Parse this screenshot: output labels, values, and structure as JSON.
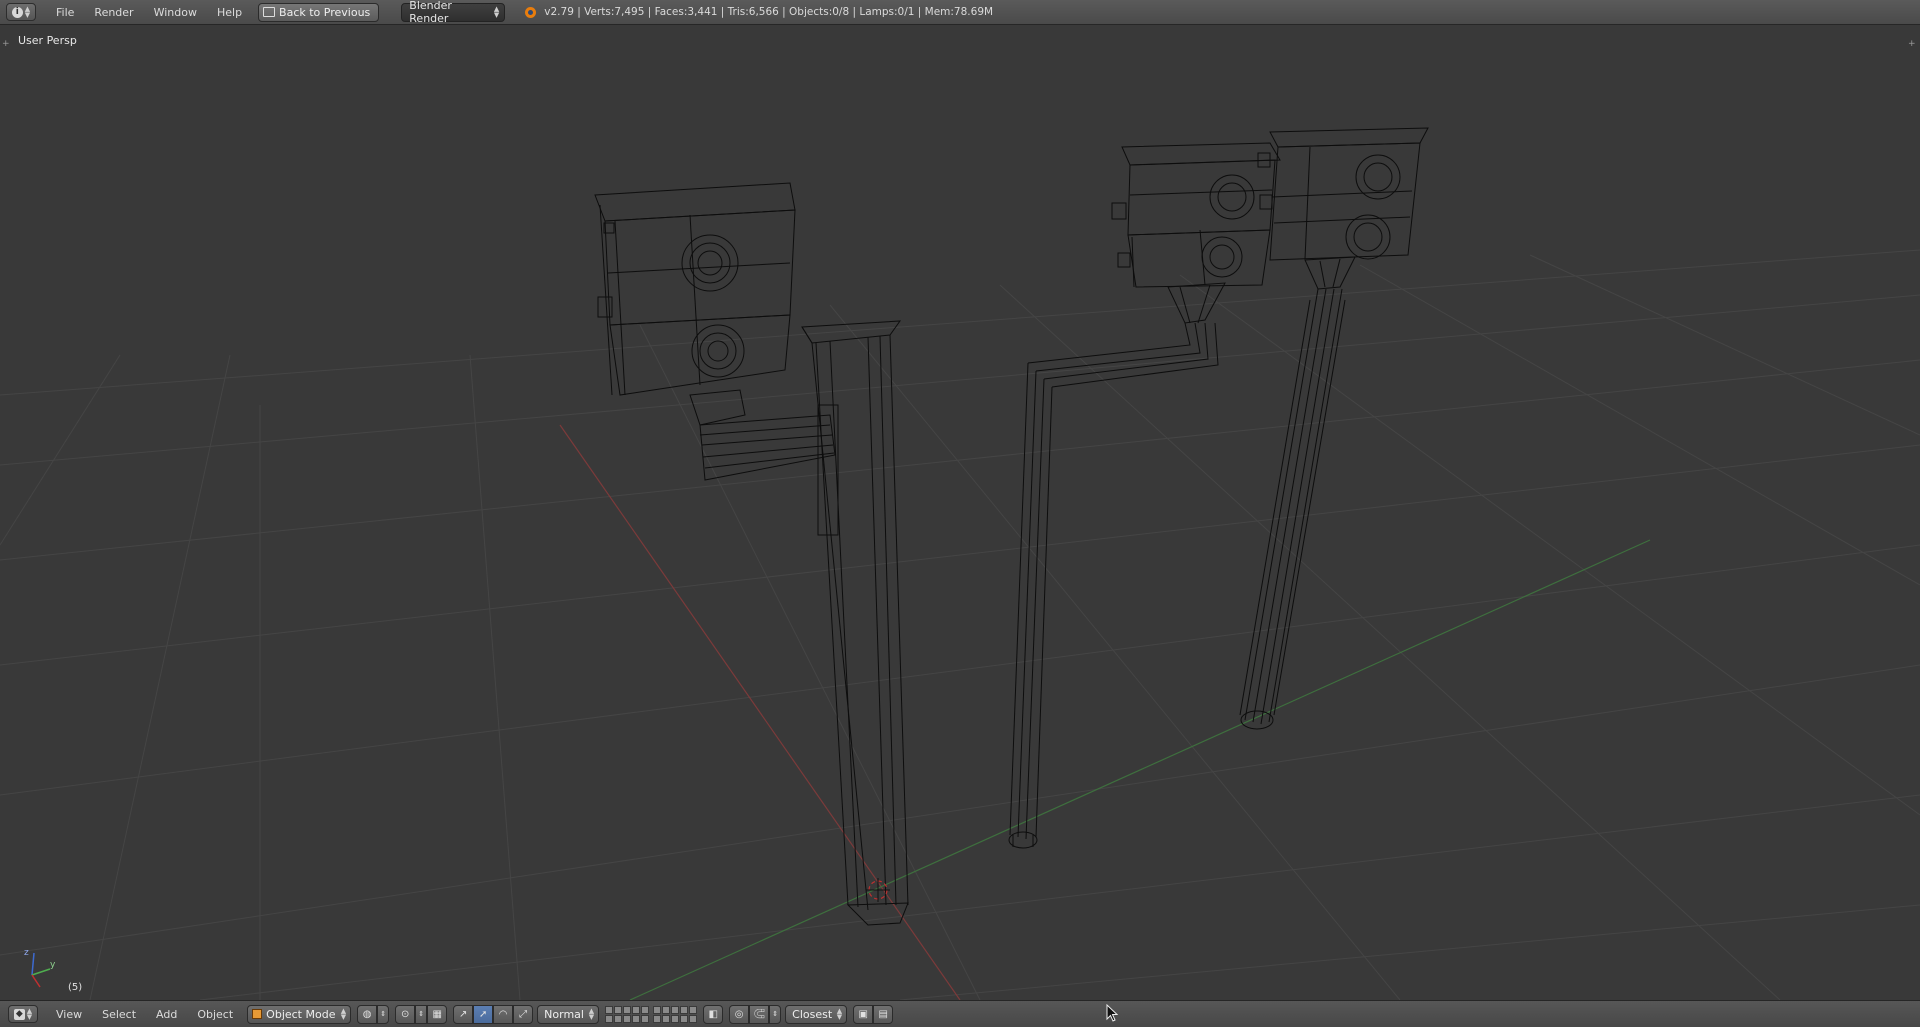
{
  "top_header": {
    "menu": [
      "File",
      "Render",
      "Window",
      "Help"
    ],
    "back_button": "Back to Previous",
    "render_engine": "Blender Render",
    "stats": "v2.79 | Verts:7,495 | Faces:3,441 | Tris:6,566 | Objects:0/8 | Lamps:0/1 | Mem:78.69M"
  },
  "viewport": {
    "view_name": "User Persp",
    "frame": "(5)"
  },
  "bottom_header": {
    "menu": [
      "View",
      "Select",
      "Add",
      "Object"
    ],
    "mode": "Object Mode",
    "transform_orientation": "Normal",
    "snap_target": "Closest"
  },
  "colors": {
    "background": "#393939",
    "grid": "#4a4a4a",
    "x_axis": "#8a3b3b",
    "y_axis": "#3f7a3f",
    "wire": "#0a0a0a",
    "active_button": "#5c7fb4"
  }
}
